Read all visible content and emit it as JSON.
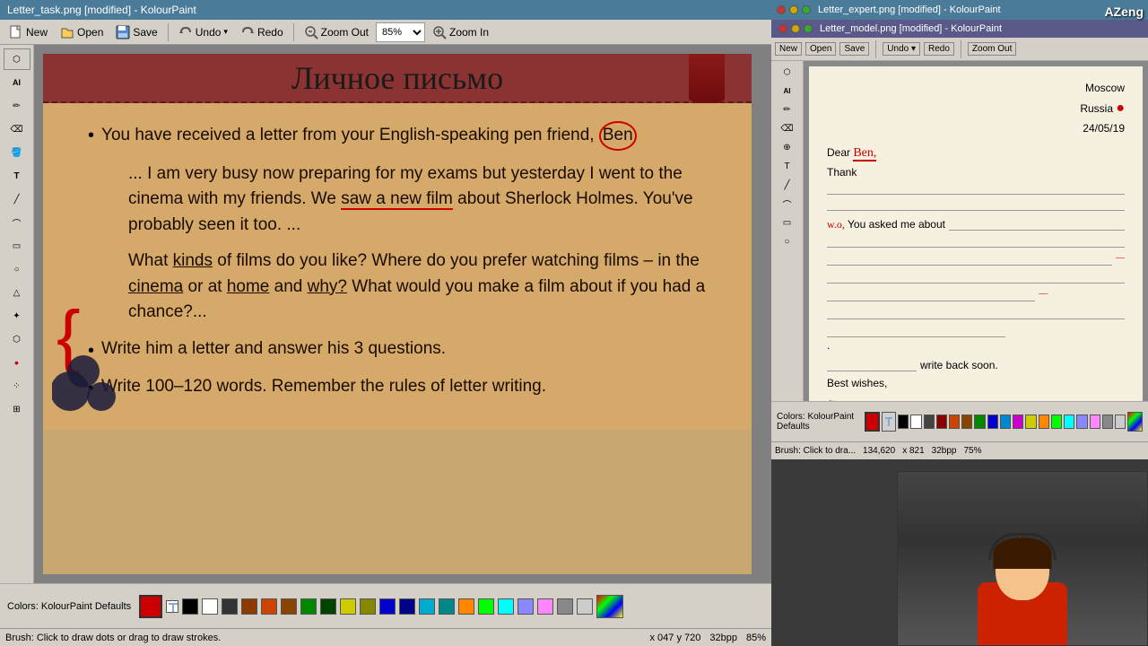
{
  "main_window": {
    "title": "Letter_task.png [modified] - KolourPaint",
    "menu": {
      "items": [
        "New",
        "Open",
        "Save",
        "Undo",
        "Redo",
        "Zoom Out",
        "85%",
        "Zoom In"
      ]
    },
    "canvas": {
      "title": "Личное письмо",
      "handwriting": "Moscow,  Russia",
      "bookmark_visible": true,
      "bullets": [
        {
          "text": "You have received a letter from your English-speaking pen friend, Ben"
        },
        {
          "text_parts": [
            "... I am very busy now preparing for my exams but yesterday I went to the cinema with my friends. We saw a new film about Sherlock Holmes. You've probably seen it too. ...",
            "What kinds of films do you like? Where do you prefer watching films – in the cinema or at home and why? What would you make a film about if you had a chance?..."
          ]
        },
        {
          "text": "Write him a letter and answer his 3 questions."
        },
        {
          "text": "Write 100–120 words. Remember the rules of letter writing."
        }
      ]
    },
    "color_palette": {
      "label": "Colors: KolourPaint Defaults",
      "colors": [
        "#cc0000",
        "#ffffff",
        "#000000",
        "#8b0000",
        "#cc4400",
        "#884400",
        "#008800",
        "#004400",
        "#0000cc",
        "#000088",
        "#cc00cc",
        "#880088",
        "#00cccc",
        "#008888",
        "#ffff00",
        "#888800",
        "#ff8800",
        "#00ff00",
        "#00ffff",
        "#8888ff",
        "#ff88ff",
        "#888888",
        "#cccccc"
      ]
    },
    "status": "Brush: Click to draw dots or drag to draw strokes.",
    "coordinates": "x 047  y 720",
    "bit_depth": "32bpp",
    "zoom": "85%"
  },
  "right_window_top": {
    "title": "Letter_expert.png [modified] - KolourPaint"
  },
  "right_window_main": {
    "title": "Letter_model.png [modified] - KolourPaint",
    "menu_items": [
      "New",
      "Open",
      "Save",
      "Undo",
      "Redo",
      "Zoom Out"
    ],
    "letter": {
      "address": [
        "Moscow",
        "Russia ●",
        "24/05/19"
      ],
      "greeting": "Dear Ben,",
      "greeting_annotation": "Ben,",
      "body_lines": [
        "Thank",
        "",
        "You asked me about",
        "",
        "",
        "",
        "",
        "",
        "",
        "."
      ],
      "closing": "write back soon.",
      "best_wishes": "Best wishes,",
      "signature_line": "←"
    },
    "palette_label": "Colors: KolourPaint Defaults",
    "status": "Brush: Click to dra...",
    "coordinates": "134,620",
    "dimensions": "x 821",
    "bit_depth": "32bpp",
    "zoom": "75%"
  },
  "watermark": "AZeng",
  "tools": {
    "left_icons": [
      "⬡",
      "A",
      "✏",
      "⬛",
      "◯",
      "🖊",
      "🖌",
      "⌫",
      "▭",
      "◯",
      "△",
      "★",
      "❮",
      "⊹",
      "✦",
      "≡"
    ]
  }
}
